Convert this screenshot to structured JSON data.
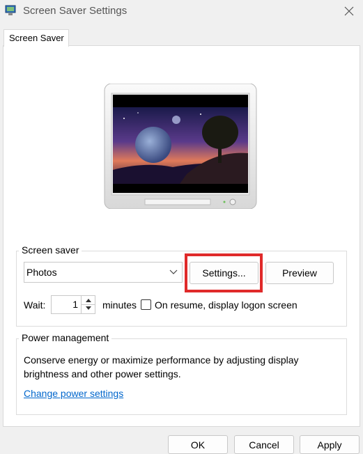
{
  "window": {
    "title": "Screen Saver Settings"
  },
  "tabs": [
    {
      "label": "Screen Saver"
    }
  ],
  "screen_saver": {
    "legend": "Screen saver",
    "selected": "Photos",
    "settings_label": "Settings...",
    "preview_label": "Preview",
    "wait_label": "Wait:",
    "wait_value": "1",
    "minutes_label": "minutes",
    "resume_label": "On resume, display logon screen",
    "resume_checked": false
  },
  "power": {
    "legend": "Power management",
    "description": "Conserve energy or maximize performance by adjusting display brightness and other power settings.",
    "link": "Change power settings"
  },
  "buttons": {
    "ok": "OK",
    "cancel": "Cancel",
    "apply": "Apply"
  },
  "colors": {
    "highlight": "#e02a2a",
    "link": "#0066cc"
  }
}
